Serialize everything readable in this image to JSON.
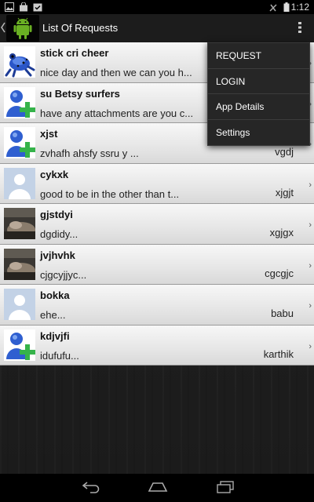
{
  "status_bar": {
    "time": "1:12",
    "icons": [
      "image-notification-icon",
      "shop-bag-icon",
      "calendar-check-icon",
      "signal-off-icon",
      "battery-icon"
    ]
  },
  "action_bar": {
    "title": "List Of Requests",
    "up_icon": "chevron-left-icon",
    "logo_icon": "android-robot-icon",
    "overflow_icon": "vertical-dots-icon"
  },
  "requests": [
    {
      "name": "stick cri cheer",
      "message": "nice day and then we can you h...",
      "user": "",
      "avatar": "frog"
    },
    {
      "name": "su Betsy surfers",
      "message": "have any attachments are you c...",
      "user": "",
      "avatar": "add-user"
    },
    {
      "name": "xjst",
      "message": "zvhafh ahsfy ssru y ...",
      "user": "vgdj",
      "avatar": "add-user"
    },
    {
      "name": "cykxk",
      "message": "good to be in the other than t...",
      "user": "xjgjt",
      "avatar": "default"
    },
    {
      "name": "gjstdyi",
      "message": "dgdidy...",
      "user": "xgjgx",
      "avatar": "photo"
    },
    {
      "name": "jvjhvhk",
      "message": "cjgcyjjyc...",
      "user": "cgcgjc",
      "avatar": "photo"
    },
    {
      "name": "bokka",
      "message": "ehe...",
      "user": "babu",
      "avatar": "default"
    },
    {
      "name": "kdjvjfi",
      "message": "idufufu...",
      "user": "karthik",
      "avatar": "add-user"
    }
  ],
  "menu": {
    "items": [
      "REQUEST",
      "LOGIN",
      "App Details",
      "Settings"
    ]
  },
  "nav_bar": {
    "icons": [
      "back-icon",
      "home-icon",
      "recent-apps-icon"
    ]
  },
  "colors": {
    "row_background": "#e6e6e6",
    "action_bar": "#1c1c1c",
    "menu_background": "#262626",
    "android_green": "#6ab023"
  }
}
